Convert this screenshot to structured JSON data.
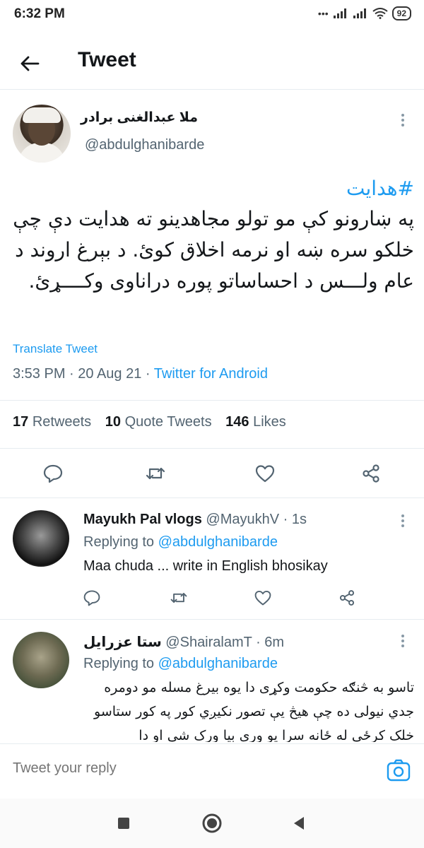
{
  "status_bar": {
    "time": "6:32 PM",
    "battery": "92"
  },
  "header": {
    "title": "Tweet"
  },
  "tweet": {
    "author_name": "ملا عبدالغنی برادر",
    "author_handle": "@abdulghanibarde",
    "hashtag": "#هدایت",
    "body": "په ښارونو کې مو تولو مجاهدینو ته هدایت دې چې خلکو سره ښه او نرمه اخلاق کوئ. د بېرغ اروند د عام ولـــس د احساساتو پوره دراناوی وکــــړئ.",
    "translate_label": "Translate Tweet",
    "time": "3:53 PM",
    "date": "20 Aug 21",
    "source": "Twitter for Android",
    "retweets_count": "17",
    "retweets_label": "Retweets",
    "quotes_count": "10",
    "quotes_label": "Quote Tweets",
    "likes_count": "146",
    "likes_label": "Likes"
  },
  "replies": [
    {
      "name": "Mayukh Pal vlogs",
      "handle": "@MayukhV",
      "time": "1s",
      "replying_label": "Replying to",
      "replying_to": "@abdulghanibarde",
      "text": "Maa chuda ... write in English bhosikay"
    },
    {
      "name": "ستا عزرایل",
      "handle": "@ShairalamT",
      "time": "6m",
      "replying_label": "Replying to",
      "replying_to": "@abdulghanibarde",
      "text": "تاسو به څنګه حکومت وکړی دا یوه بیرغ مسله مو دومره جدي نیولی ده چې هیڅ یې تصور نکیږي کور په کور ستاسو خلک کرځي له ځانه سرا یو وری بیا ورک شی او دا"
    }
  ],
  "compose": {
    "placeholder": "Tweet your reply"
  },
  "colors": {
    "accent": "#1d9bf0",
    "secondary_text": "#536471",
    "divider": "#e6ecf0"
  },
  "icons": [
    "back-arrow-icon",
    "more-icon",
    "reply-icon",
    "retweet-icon",
    "like-icon",
    "share-icon",
    "camera-icon",
    "nav-recents-icon",
    "nav-home-icon",
    "nav-back-icon"
  ]
}
